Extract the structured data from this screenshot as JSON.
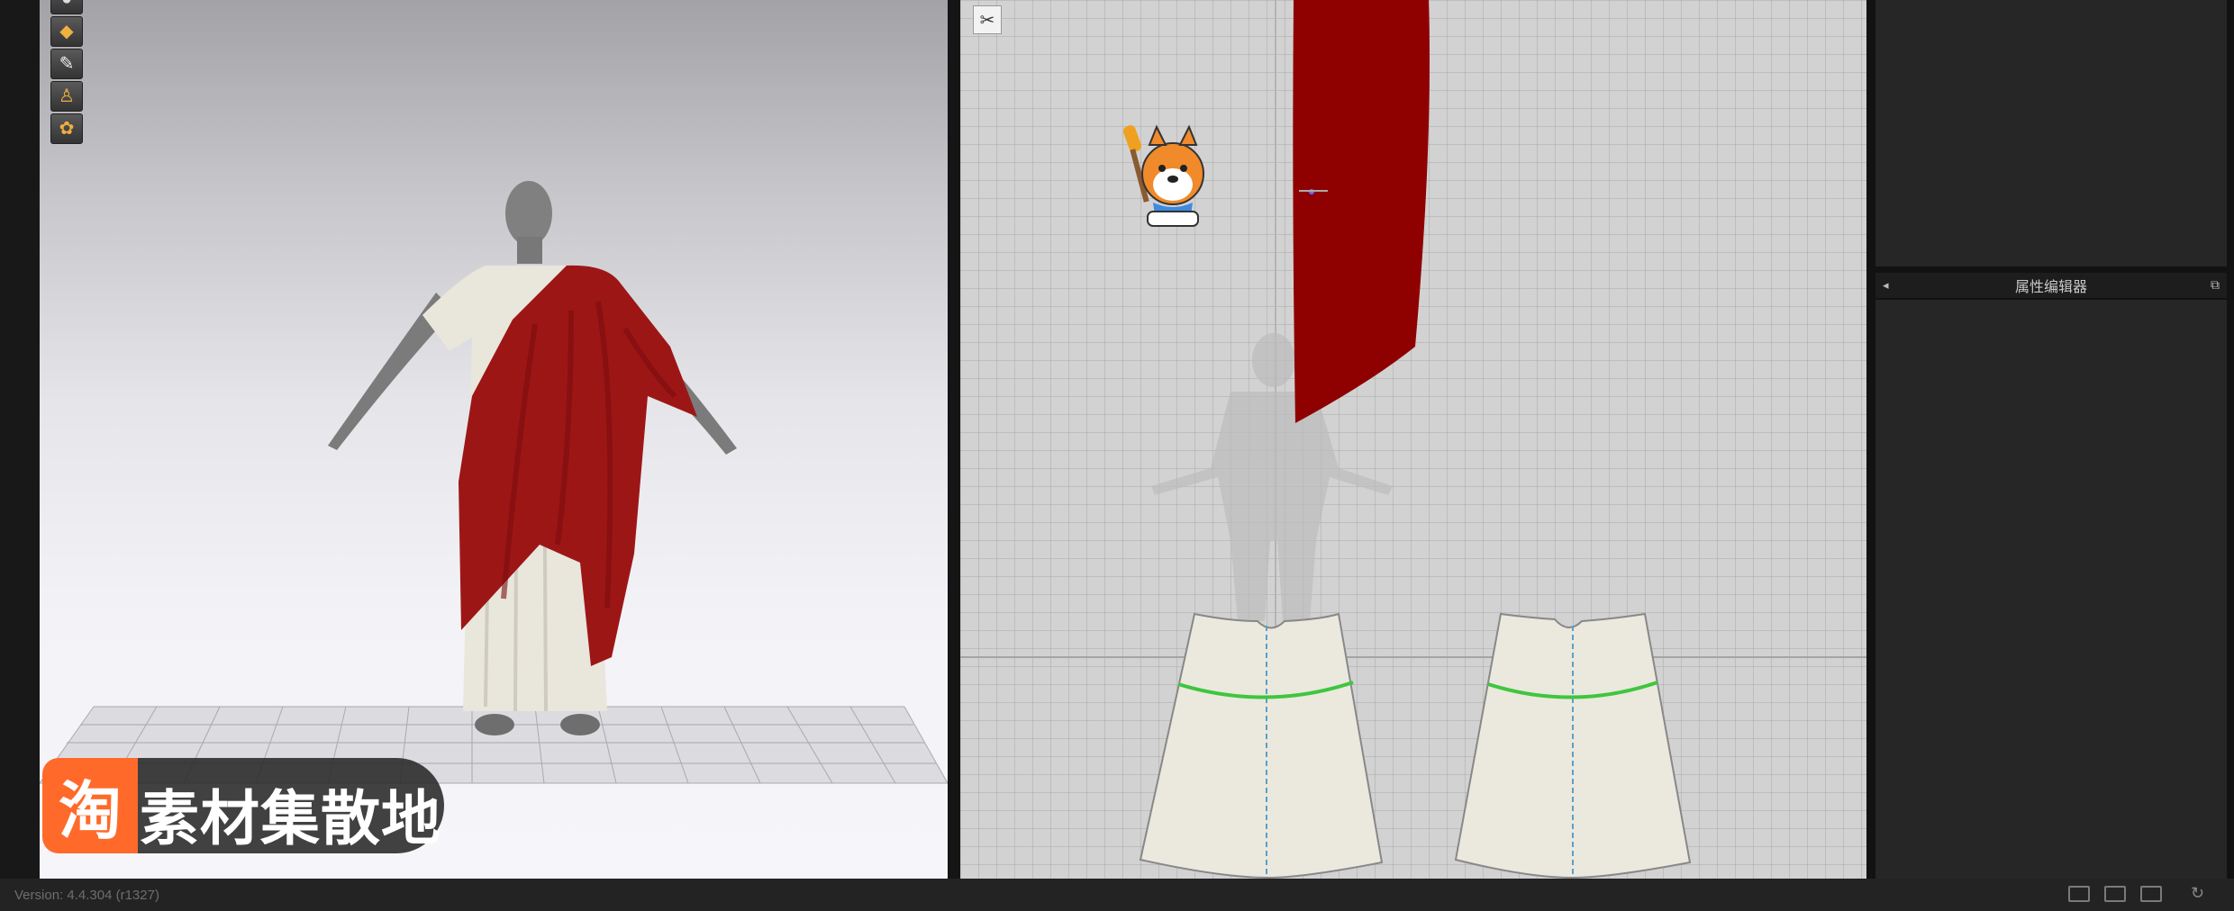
{
  "statusbar": {
    "version": "Version: 4.4.304 (r1327)"
  },
  "property_editor": {
    "title": "属性编辑器"
  },
  "watermark": {
    "logo_char": "淘",
    "text": "素材集散地"
  },
  "toolbar_3d": {
    "icons": [
      "display-icon",
      "fabric-icon",
      "brush-icon",
      "avatar-icon",
      "palette-icon"
    ]
  },
  "colors": {
    "drape": "#9d1616",
    "robe": "#e9e6dc",
    "seam": "#3ec63e",
    "accent": "#ff6a2a"
  }
}
